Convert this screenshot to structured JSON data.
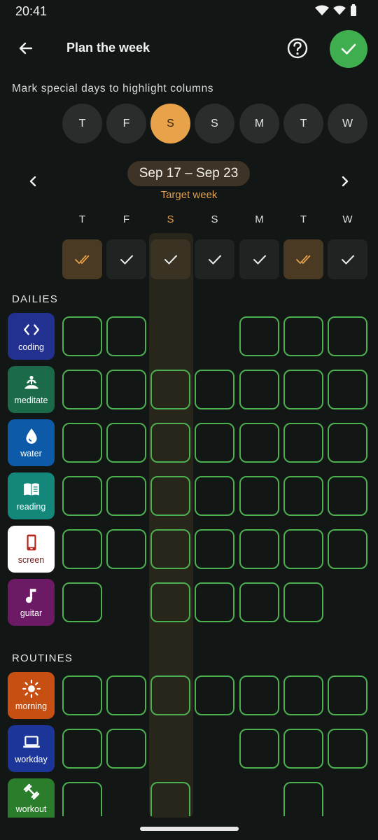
{
  "status": {
    "time": "20:41"
  },
  "header": {
    "title": "Plan the week"
  },
  "hint": "Mark special days to highlight columns",
  "day_chips": [
    {
      "label": "T",
      "special": false
    },
    {
      "label": "F",
      "special": false
    },
    {
      "label": "S",
      "special": true
    },
    {
      "label": "S",
      "special": false
    },
    {
      "label": "M",
      "special": false
    },
    {
      "label": "T",
      "special": false
    },
    {
      "label": "W",
      "special": false
    }
  ],
  "week": {
    "range": "Sep 17 – Sep 23",
    "subtitle": "Target week"
  },
  "day_headers": [
    "T",
    "F",
    "S",
    "S",
    "M",
    "T",
    "W"
  ],
  "column_status": [
    "partial",
    "check",
    "check",
    "check",
    "check",
    "partial",
    "check"
  ],
  "sections": {
    "dailies": "DAILIES",
    "routines": "ROUTINES"
  },
  "habits": [
    {
      "name": "coding",
      "icon": "code-icon",
      "color": "#22318f",
      "days": [
        1,
        1,
        0,
        0,
        1,
        1,
        1
      ]
    },
    {
      "name": "meditate",
      "icon": "meditate-icon",
      "color": "#1b6b4a",
      "days": [
        1,
        1,
        1,
        1,
        1,
        1,
        1
      ]
    },
    {
      "name": "water",
      "icon": "water-drop-icon",
      "color": "#0d5aa8",
      "days": [
        1,
        1,
        1,
        1,
        1,
        1,
        1
      ]
    },
    {
      "name": "reading",
      "icon": "book-icon",
      "color": "#12877a",
      "days": [
        1,
        1,
        1,
        1,
        1,
        1,
        1
      ]
    },
    {
      "name": "screen",
      "icon": "phone-icon",
      "color": "#ffffff",
      "days": [
        1,
        1,
        1,
        1,
        1,
        1,
        1
      ]
    },
    {
      "name": "guitar",
      "icon": "music-note-icon",
      "color": "#6d1a66",
      "days": [
        1,
        0,
        1,
        1,
        1,
        1,
        0
      ]
    }
  ],
  "routines": [
    {
      "name": "morning",
      "icon": "sun-icon",
      "color": "#c84f12",
      "days": [
        1,
        1,
        1,
        1,
        1,
        1,
        1
      ]
    },
    {
      "name": "workday",
      "icon": "laptop-icon",
      "color": "#1c3598",
      "days": [
        1,
        1,
        0,
        0,
        1,
        1,
        1
      ]
    },
    {
      "name": "workout",
      "icon": "dumbbell-icon",
      "color": "#2a7d2a",
      "days": [
        1,
        0,
        1,
        0,
        0,
        1,
        0
      ]
    }
  ],
  "colors": {
    "accent": "#e8a24a",
    "confirm": "#3fae4f",
    "cell_border": "#4caf50",
    "background": "#121614"
  }
}
